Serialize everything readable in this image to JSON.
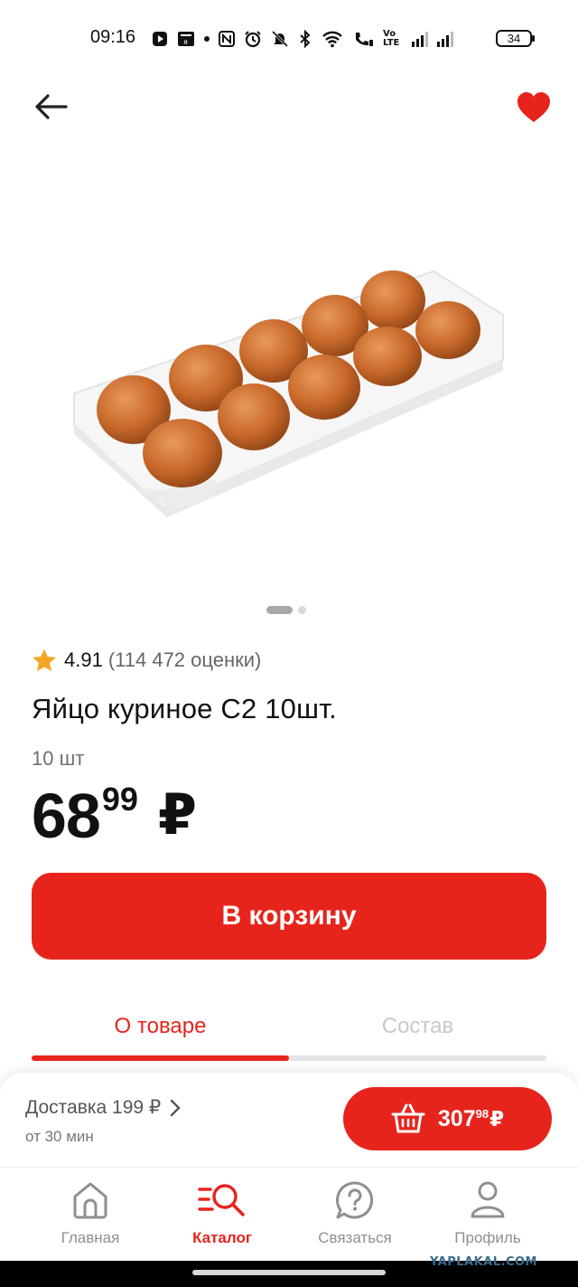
{
  "status_bar": {
    "time": "09:16",
    "network_label": "Vo LTE",
    "battery_level": "34"
  },
  "header": {
    "back_icon": "arrow-left-icon",
    "favorite_icon": "heart-icon",
    "favorite_color": "#e7241c"
  },
  "product": {
    "image": "egg-carton-photo",
    "gallery": {
      "current": 1,
      "total": 2
    },
    "rating_score": "4.91",
    "rating_count": "(114 472 оценки)",
    "title": "Яйцо куриное С2 10шт.",
    "quantity": "10 шт",
    "price_rubles": "68",
    "price_kopecks": "99",
    "currency": "₽"
  },
  "actions": {
    "add_to_cart_label": "В корзину"
  },
  "tabs": [
    {
      "label": "О товаре",
      "active": true
    },
    {
      "label": "Состав",
      "active": false
    }
  ],
  "delivery": {
    "label": "Доставка 199 ₽",
    "time": "от 30 мин"
  },
  "basket": {
    "total_rubles": "307",
    "total_kopecks": "98",
    "currency": "₽"
  },
  "bottom_nav": [
    {
      "label": "Главная",
      "icon": "home-icon",
      "active": false
    },
    {
      "label": "Каталог",
      "icon": "catalog-search-icon",
      "active": true
    },
    {
      "label": "Связаться",
      "icon": "help-chat-icon",
      "active": false
    },
    {
      "label": "Профиль",
      "icon": "profile-icon",
      "active": false
    }
  ],
  "watermark": "YAPLAKAL.COM",
  "colors": {
    "accent": "#e7241c",
    "text": "#111111",
    "muted": "#8f8f8f"
  }
}
